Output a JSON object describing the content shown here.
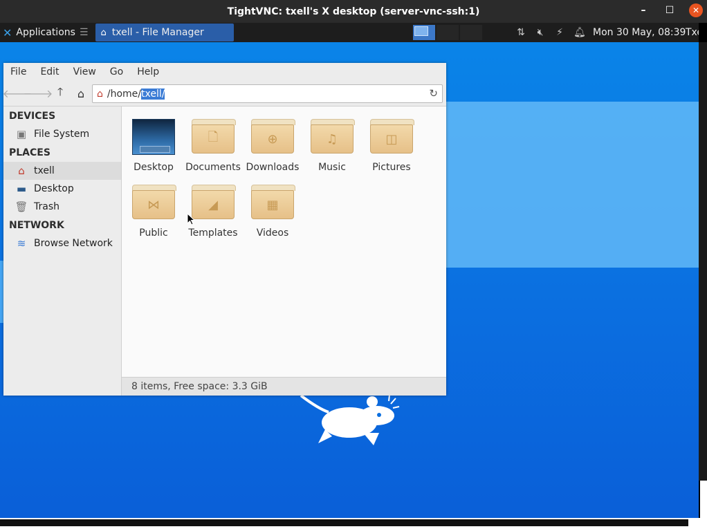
{
  "vnc": {
    "title": "TightVNC: txell's X desktop (server-vnc-ssh:1)",
    "minimize_icon": "minimize-icon",
    "maximize_icon": "maximize-icon",
    "close_icon": "close-icon"
  },
  "panel": {
    "applications_label": "Applications",
    "task_label": "txell - File Manager",
    "clock": "Mon 30 May, 08:39",
    "user": "Txe"
  },
  "file_manager": {
    "menu": [
      "File",
      "Edit",
      "View",
      "Go",
      "Help"
    ],
    "path_base": "/home/",
    "path_selected": "txell/",
    "sidebar": {
      "devices_heading": "DEVICES",
      "places_heading": "PLACES",
      "network_heading": "NETWORK",
      "devices": [
        "File System"
      ],
      "places": [
        "txell",
        "Desktop",
        "Trash"
      ],
      "network": [
        "Browse Network"
      ]
    },
    "items": [
      "Desktop",
      "Documents",
      "Downloads",
      "Music",
      "Pictures",
      "Public",
      "Templates",
      "Videos"
    ],
    "status": "8 items, Free space: 3.3 GiB"
  },
  "colors": {
    "accent": "#3a7bd5",
    "folder": "#e6c088",
    "desktop": "#0b6fe0"
  }
}
